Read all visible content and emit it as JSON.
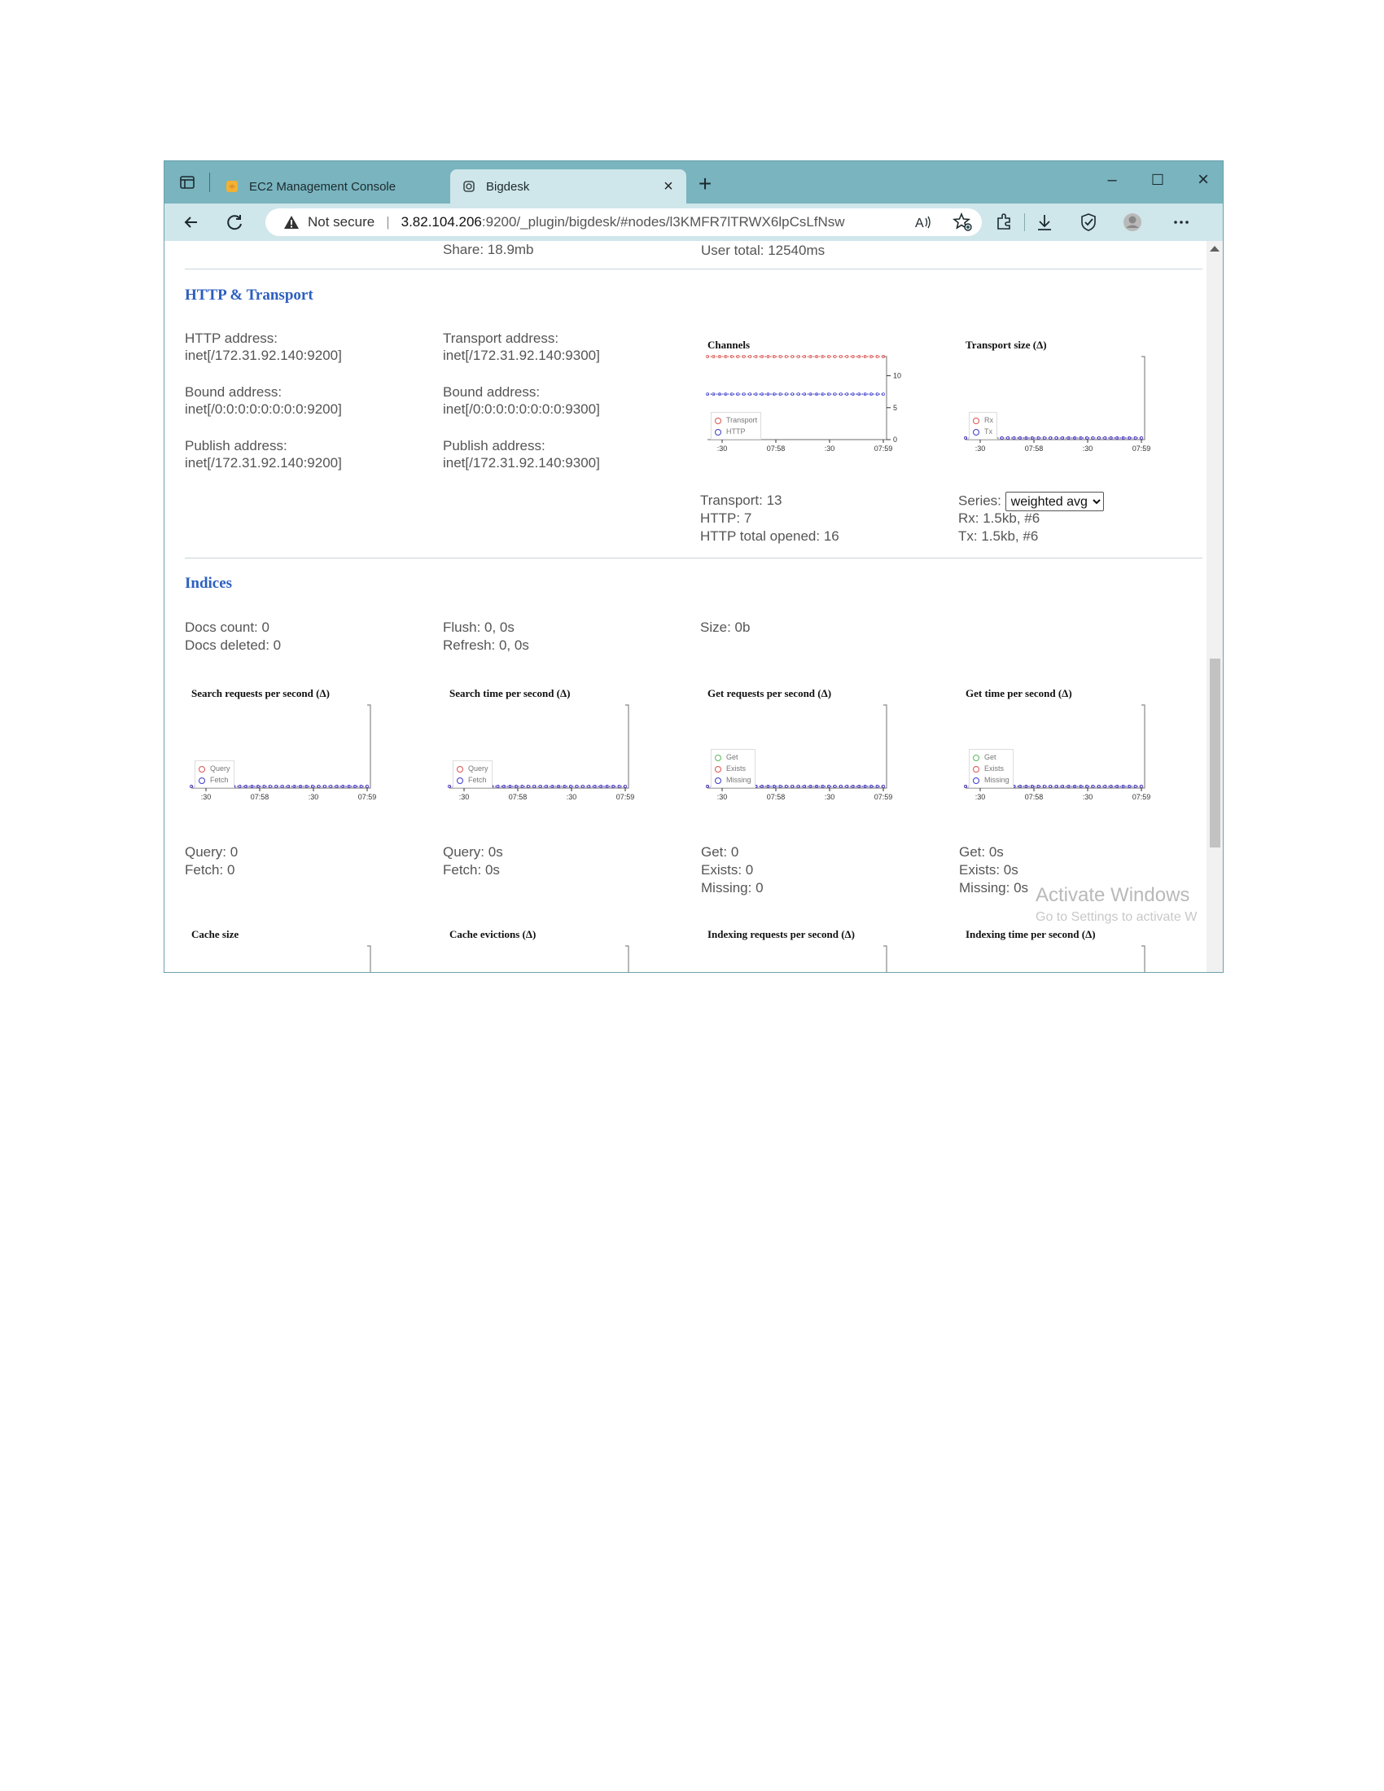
{
  "browser": {
    "tabs": [
      {
        "title": "EC2 Management Console",
        "close": "×"
      },
      {
        "title": "Bigdesk",
        "close": "×"
      }
    ],
    "new_tab": "+",
    "window_controls": {
      "minimize": "–",
      "maximize": "☐",
      "close": "×"
    },
    "address": {
      "warning": "Not secure",
      "separator": "|",
      "host": "3.82.104.206",
      "path": ":9200/_plugin/bigdesk/#nodes/l3KMFR7lTRWX6lpCsLfNsw"
    }
  },
  "top_row": {
    "share": "Share: 18.9mb",
    "user_total": "User total: 12540ms"
  },
  "http_transport": {
    "title": "HTTP & Transport",
    "http_address_label": "HTTP address:",
    "http_address_value": "inet[/172.31.92.140:9200]",
    "http_bound_label": "Bound address:",
    "http_bound_value": "inet[/0:0:0:0:0:0:0:0:9200]",
    "http_publish_label": "Publish address:",
    "http_publish_value": "inet[/172.31.92.140:9200]",
    "transport_address_label": "Transport address:",
    "transport_address_value": "inet[/172.31.92.140:9300]",
    "transport_bound_label": "Bound address:",
    "transport_bound_value": "inet[/0:0:0:0:0:0:0:0:9300]",
    "transport_publish_label": "Publish address:",
    "transport_publish_value": "inet[/172.31.92.140:9300]",
    "channels_stats": [
      "Transport: 13",
      "HTTP: 7",
      "HTTP total opened: 16"
    ],
    "series_label": "Series:",
    "series_selected": "weighted avg",
    "size_stats": [
      "Rx: 1.5kb, #6",
      "Tx: 1.5kb, #6"
    ]
  },
  "indices": {
    "title": "Indices",
    "docs": [
      "Docs count: 0",
      "Docs deleted: 0"
    ],
    "flush": [
      "Flush: 0, 0s",
      "Refresh: 0, 0s"
    ],
    "size": "Size: 0b",
    "search_req_stats": [
      "Query: 0",
      "Fetch: 0"
    ],
    "search_time_stats": [
      "Query: 0s",
      "Fetch: 0s"
    ],
    "get_req_stats": [
      "Get: 0",
      "Exists: 0",
      "Missing: 0"
    ],
    "get_time_stats": [
      "Get: 0s",
      "Exists: 0s",
      "Missing: 0s"
    ]
  },
  "watermark": {
    "line1": "Activate Windows",
    "line2": "Go to Settings to activate W"
  },
  "colors": {
    "tabbar": "#79b4bf",
    "addressbar": "#cfe6ea",
    "section_title": "#2c5fc0",
    "series_red": "#d9534f",
    "series_blue": "#3a3acc",
    "series_green": "#5cb85c"
  },
  "chart_data": [
    {
      "id": "channels",
      "type": "line",
      "title": "Channels",
      "x_ticks": [
        ":30",
        "07:58",
        ":30",
        "07:59"
      ],
      "y_ticks": [
        "0",
        "5",
        "10"
      ],
      "ylim": [
        0,
        13
      ],
      "legend_placement": "bottom-left",
      "series": [
        {
          "name": "Transport",
          "color": "#d9534f",
          "values": [
            13,
            13,
            13,
            13,
            13,
            13,
            13,
            13,
            13,
            13,
            13,
            13,
            13,
            13,
            13,
            13,
            13,
            13,
            13,
            13,
            13,
            13,
            13,
            13,
            13,
            13,
            13,
            13,
            13,
            13
          ]
        },
        {
          "name": "HTTP",
          "color": "#3a3acc",
          "values": [
            7,
            7,
            7,
            7,
            7,
            7,
            7,
            7,
            7,
            7,
            7,
            7,
            7,
            7,
            7,
            7,
            7,
            7,
            7,
            7,
            7,
            7,
            7,
            7,
            7,
            7,
            7,
            7,
            7,
            7
          ]
        }
      ]
    },
    {
      "id": "transport_size",
      "type": "line",
      "title": "Transport size (Δ)",
      "x_ticks": [
        ":30",
        "07:58",
        ":30",
        "07:59"
      ],
      "legend_placement": "bottom-left",
      "series": [
        {
          "name": "Rx",
          "color": "#d9534f",
          "values": [
            0,
            0,
            0,
            0,
            0,
            0,
            0,
            0,
            0,
            0,
            0,
            0,
            0,
            0,
            0,
            0,
            0,
            0,
            0,
            0,
            0,
            0,
            0,
            0,
            0,
            0,
            0,
            0,
            0,
            0
          ]
        },
        {
          "name": "Tx",
          "color": "#3a3acc",
          "values": [
            0,
            0,
            0,
            0,
            0,
            0,
            0,
            0,
            0,
            0,
            0,
            0,
            0,
            0,
            0,
            0,
            0,
            0,
            0,
            0,
            0,
            0,
            0,
            0,
            0,
            0,
            0,
            0,
            0,
            0
          ]
        }
      ]
    },
    {
      "id": "search_requests",
      "type": "line",
      "title": "Search requests per second (Δ)",
      "x_ticks": [
        ":30",
        "07:58",
        ":30",
        "07:59"
      ],
      "legend_placement": "bottom-left",
      "series": [
        {
          "name": "Query",
          "color": "#d9534f",
          "values": [
            0,
            0,
            0,
            0,
            0,
            0,
            0,
            0,
            0,
            0,
            0,
            0,
            0,
            0,
            0,
            0,
            0,
            0,
            0,
            0,
            0,
            0,
            0,
            0,
            0,
            0,
            0,
            0,
            0,
            0
          ]
        },
        {
          "name": "Fetch",
          "color": "#3a3acc",
          "values": [
            0,
            0,
            0,
            0,
            0,
            0,
            0,
            0,
            0,
            0,
            0,
            0,
            0,
            0,
            0,
            0,
            0,
            0,
            0,
            0,
            0,
            0,
            0,
            0,
            0,
            0,
            0,
            0,
            0,
            0
          ]
        }
      ]
    },
    {
      "id": "search_time",
      "type": "line",
      "title": "Search time per second (Δ)",
      "x_ticks": [
        ":30",
        "07:58",
        ":30",
        "07:59"
      ],
      "legend_placement": "bottom-left",
      "series": [
        {
          "name": "Query",
          "color": "#d9534f",
          "values": [
            0,
            0,
            0,
            0,
            0,
            0,
            0,
            0,
            0,
            0,
            0,
            0,
            0,
            0,
            0,
            0,
            0,
            0,
            0,
            0,
            0,
            0,
            0,
            0,
            0,
            0,
            0,
            0,
            0,
            0
          ]
        },
        {
          "name": "Fetch",
          "color": "#3a3acc",
          "values": [
            0,
            0,
            0,
            0,
            0,
            0,
            0,
            0,
            0,
            0,
            0,
            0,
            0,
            0,
            0,
            0,
            0,
            0,
            0,
            0,
            0,
            0,
            0,
            0,
            0,
            0,
            0,
            0,
            0,
            0
          ]
        }
      ]
    },
    {
      "id": "get_requests",
      "type": "line",
      "title": "Get requests per second (Δ)",
      "x_ticks": [
        ":30",
        "07:58",
        ":30",
        "07:59"
      ],
      "legend_placement": "bottom-left",
      "series": [
        {
          "name": "Get",
          "color": "#5cb85c",
          "values": [
            0,
            0,
            0,
            0,
            0,
            0,
            0,
            0,
            0,
            0,
            0,
            0,
            0,
            0,
            0,
            0,
            0,
            0,
            0,
            0,
            0,
            0,
            0,
            0,
            0,
            0,
            0,
            0,
            0,
            0
          ]
        },
        {
          "name": "Exists",
          "color": "#d9534f",
          "values": [
            0,
            0,
            0,
            0,
            0,
            0,
            0,
            0,
            0,
            0,
            0,
            0,
            0,
            0,
            0,
            0,
            0,
            0,
            0,
            0,
            0,
            0,
            0,
            0,
            0,
            0,
            0,
            0,
            0,
            0
          ]
        },
        {
          "name": "Missing",
          "color": "#3a3acc",
          "values": [
            0,
            0,
            0,
            0,
            0,
            0,
            0,
            0,
            0,
            0,
            0,
            0,
            0,
            0,
            0,
            0,
            0,
            0,
            0,
            0,
            0,
            0,
            0,
            0,
            0,
            0,
            0,
            0,
            0,
            0
          ]
        }
      ]
    },
    {
      "id": "get_time",
      "type": "line",
      "title": "Get time per second (Δ)",
      "x_ticks": [
        ":30",
        "07:58",
        ":30",
        "07:59"
      ],
      "legend_placement": "bottom-left",
      "series": [
        {
          "name": "Get",
          "color": "#5cb85c",
          "values": [
            0,
            0,
            0,
            0,
            0,
            0,
            0,
            0,
            0,
            0,
            0,
            0,
            0,
            0,
            0,
            0,
            0,
            0,
            0,
            0,
            0,
            0,
            0,
            0,
            0,
            0,
            0,
            0,
            0,
            0
          ]
        },
        {
          "name": "Exists",
          "color": "#d9534f",
          "values": [
            0,
            0,
            0,
            0,
            0,
            0,
            0,
            0,
            0,
            0,
            0,
            0,
            0,
            0,
            0,
            0,
            0,
            0,
            0,
            0,
            0,
            0,
            0,
            0,
            0,
            0,
            0,
            0,
            0,
            0
          ]
        },
        {
          "name": "Missing",
          "color": "#3a3acc",
          "values": [
            0,
            0,
            0,
            0,
            0,
            0,
            0,
            0,
            0,
            0,
            0,
            0,
            0,
            0,
            0,
            0,
            0,
            0,
            0,
            0,
            0,
            0,
            0,
            0,
            0,
            0,
            0,
            0,
            0,
            0
          ]
        }
      ]
    },
    {
      "id": "cache_size",
      "type": "line",
      "title": "Cache size",
      "series": []
    },
    {
      "id": "cache_evictions",
      "type": "line",
      "title": "Cache evictions (Δ)",
      "series": []
    },
    {
      "id": "indexing_requests",
      "type": "line",
      "title": "Indexing requests per second (Δ)",
      "series": []
    },
    {
      "id": "indexing_time",
      "type": "line",
      "title": "Indexing time per second (Δ)",
      "series": []
    }
  ]
}
